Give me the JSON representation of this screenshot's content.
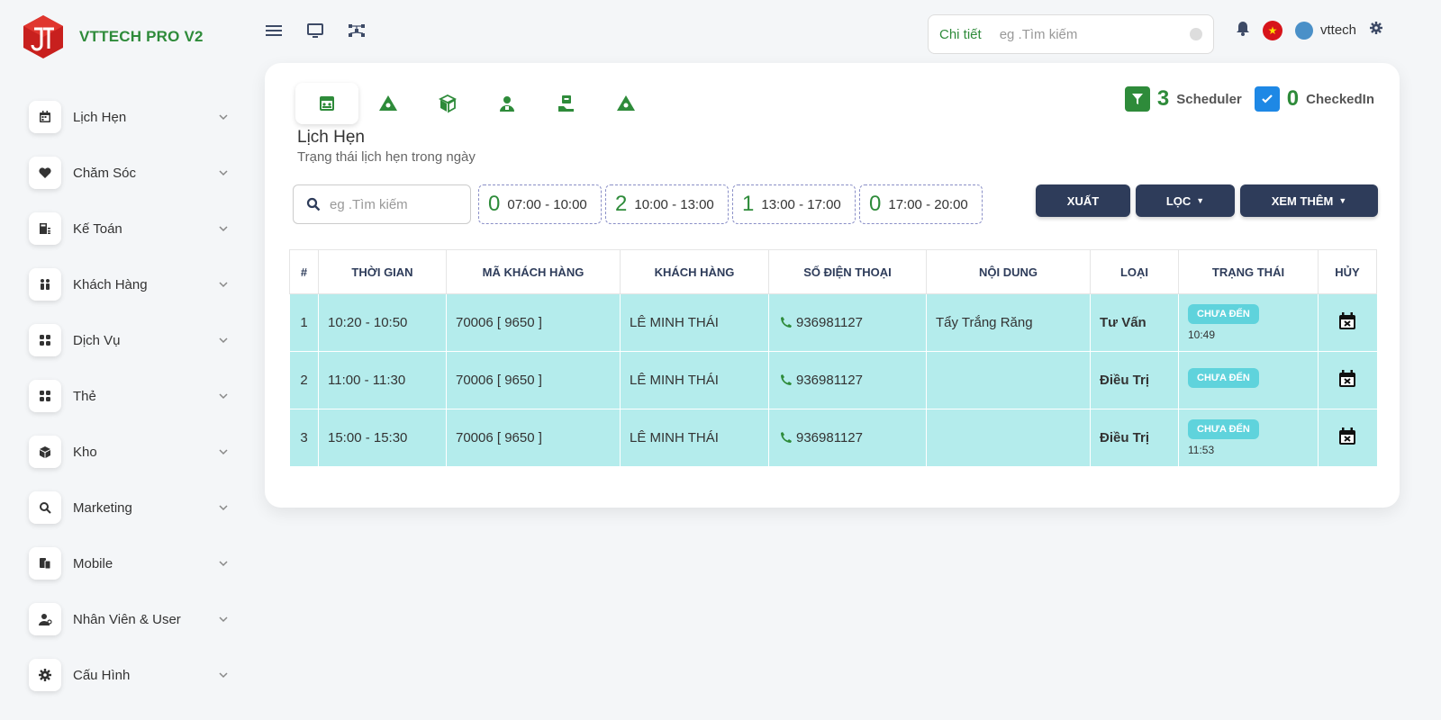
{
  "app": {
    "title": "VTTECH PRO V2"
  },
  "sidebar": {
    "items": [
      {
        "label": "Lịch Hẹn",
        "icon": "calendar-icon"
      },
      {
        "label": "Chăm Sóc",
        "icon": "heart-icon"
      },
      {
        "label": "Kế Toán",
        "icon": "accounting-icon"
      },
      {
        "label": "Khách Hàng",
        "icon": "customers-icon"
      },
      {
        "label": "Dịch Vụ",
        "icon": "grid-icon"
      },
      {
        "label": "Thẻ",
        "icon": "card-grid-icon"
      },
      {
        "label": "Kho",
        "icon": "box-icon"
      },
      {
        "label": "Marketing",
        "icon": "marketing-icon"
      },
      {
        "label": "Mobile",
        "icon": "mobile-icon"
      },
      {
        "label": "Nhân Viên & User",
        "icon": "user-icon"
      },
      {
        "label": "Cấu Hình",
        "icon": "gear-icon"
      }
    ]
  },
  "topbar": {
    "search_label": "Chi tiết",
    "search_placeholder": "eg .Tìm kiếm",
    "username": "vttech"
  },
  "page": {
    "heading": "Lịch Hẹn",
    "subheading": "Trạng thái lịch hẹn trong ngày",
    "counters": {
      "scheduler_count": "3",
      "scheduler_label": "Scheduler",
      "checked_count": "0",
      "checked_label": "CheckedIn"
    },
    "search_placeholder": "eg .Tìm kiếm",
    "slots": [
      {
        "count": "0",
        "range": "07:00 - 10:00"
      },
      {
        "count": "2",
        "range": "10:00 - 13:00"
      },
      {
        "count": "1",
        "range": "13:00 - 17:00"
      },
      {
        "count": "0",
        "range": "17:00 - 20:00"
      }
    ],
    "buttons": {
      "export": "XUẤT",
      "filter": "LỌC",
      "more": "XEM THÊM"
    }
  },
  "table": {
    "headers": [
      "#",
      "THỜI GIAN",
      "MÃ KHÁCH HÀNG",
      "KHÁCH HÀNG",
      "SỐ ĐIỆN THOẠI",
      "NỘI DUNG",
      "LOẠI",
      "TRẠNG THÁI",
      "HỦY"
    ],
    "rows": [
      {
        "num": "1",
        "time": "10:20 - 10:50",
        "code": "70006 [ 9650 ]",
        "customer": "LÊ MINH THÁI",
        "phone": "936981127",
        "content": "Tẩy Trắng Răng",
        "type": "Tư Vấn",
        "status": "CHƯA ĐẾN",
        "status_time": "10:49"
      },
      {
        "num": "2",
        "time": "11:00 - 11:30",
        "code": "70006 [ 9650 ]",
        "customer": "LÊ MINH THÁI",
        "phone": "936981127",
        "content": "",
        "type": "Điều Trị",
        "status": "CHƯA ĐẾN",
        "status_time": ""
      },
      {
        "num": "3",
        "time": "15:00 - 15:30",
        "code": "70006 [ 9650 ]",
        "customer": "LÊ MINH THÁI",
        "phone": "936981127",
        "content": "",
        "type": "Điều Trị",
        "status": "CHƯA ĐẾN",
        "status_time": "11:53"
      }
    ]
  },
  "colors": {
    "brand": "#2e8b3a",
    "button": "#2e3c5a",
    "row": "#b4ecec",
    "badge": "#5fd3dc",
    "logo": "#c8201e"
  }
}
